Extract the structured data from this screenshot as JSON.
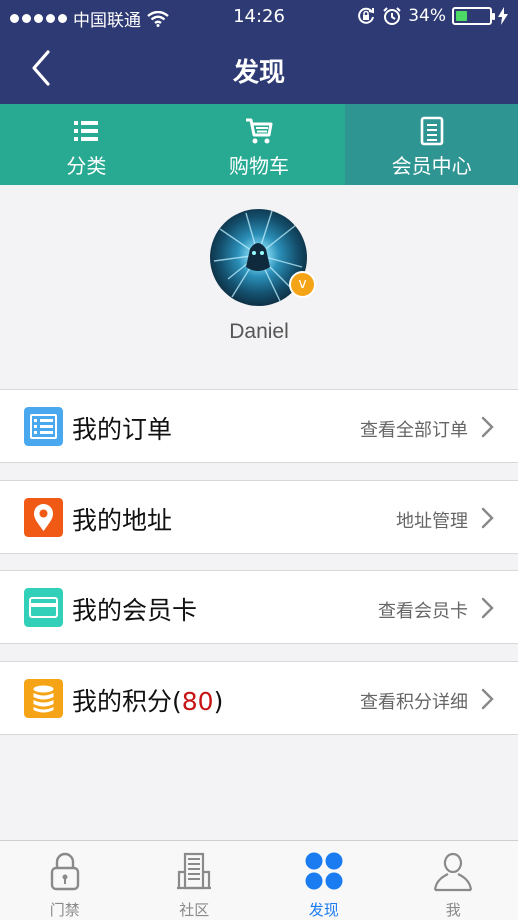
{
  "status_bar": {
    "carrier": "中国联通",
    "time": "14:26",
    "battery_percent": "34%",
    "battery_level": 0.34
  },
  "navbar": {
    "title": "发现",
    "back_icon": "chevron-left-icon"
  },
  "tabs": [
    {
      "label": "分类",
      "icon": "list-icon",
      "active": false
    },
    {
      "label": "购物车",
      "icon": "cart-icon",
      "active": false
    },
    {
      "label": "会员中心",
      "icon": "document-icon",
      "active": true
    }
  ],
  "profile": {
    "username": "Daniel",
    "badge": "v"
  },
  "rows": [
    {
      "label": "我的订单",
      "action": "查看全部订单",
      "icon": "order-list-icon",
      "color": "#4aa8ef"
    },
    {
      "label": "我的地址",
      "action": "地址管理",
      "icon": "location-pin-icon",
      "color": "#f05a14"
    },
    {
      "label": "我的会员卡",
      "action": "查看会员卡",
      "icon": "card-icon",
      "color": "#32d0b8"
    },
    {
      "label": "我的积分(",
      "points": "80",
      "label_end": ")",
      "action": "查看积分详细",
      "icon": "coin-stack-icon",
      "color": "#f5a418"
    }
  ],
  "tabbar": [
    {
      "label": "门禁",
      "icon": "lock-icon",
      "active": false
    },
    {
      "label": "社区",
      "icon": "building-icon",
      "active": false
    },
    {
      "label": "发现",
      "icon": "grid-dots-icon",
      "active": true
    },
    {
      "label": "我",
      "icon": "person-icon",
      "active": false
    }
  ],
  "colors": {
    "nav": "#2e3a73",
    "tabs": "#27a992",
    "tab_active": "#2f9593",
    "accent": "#1a7cf0",
    "points": "#c81414"
  }
}
